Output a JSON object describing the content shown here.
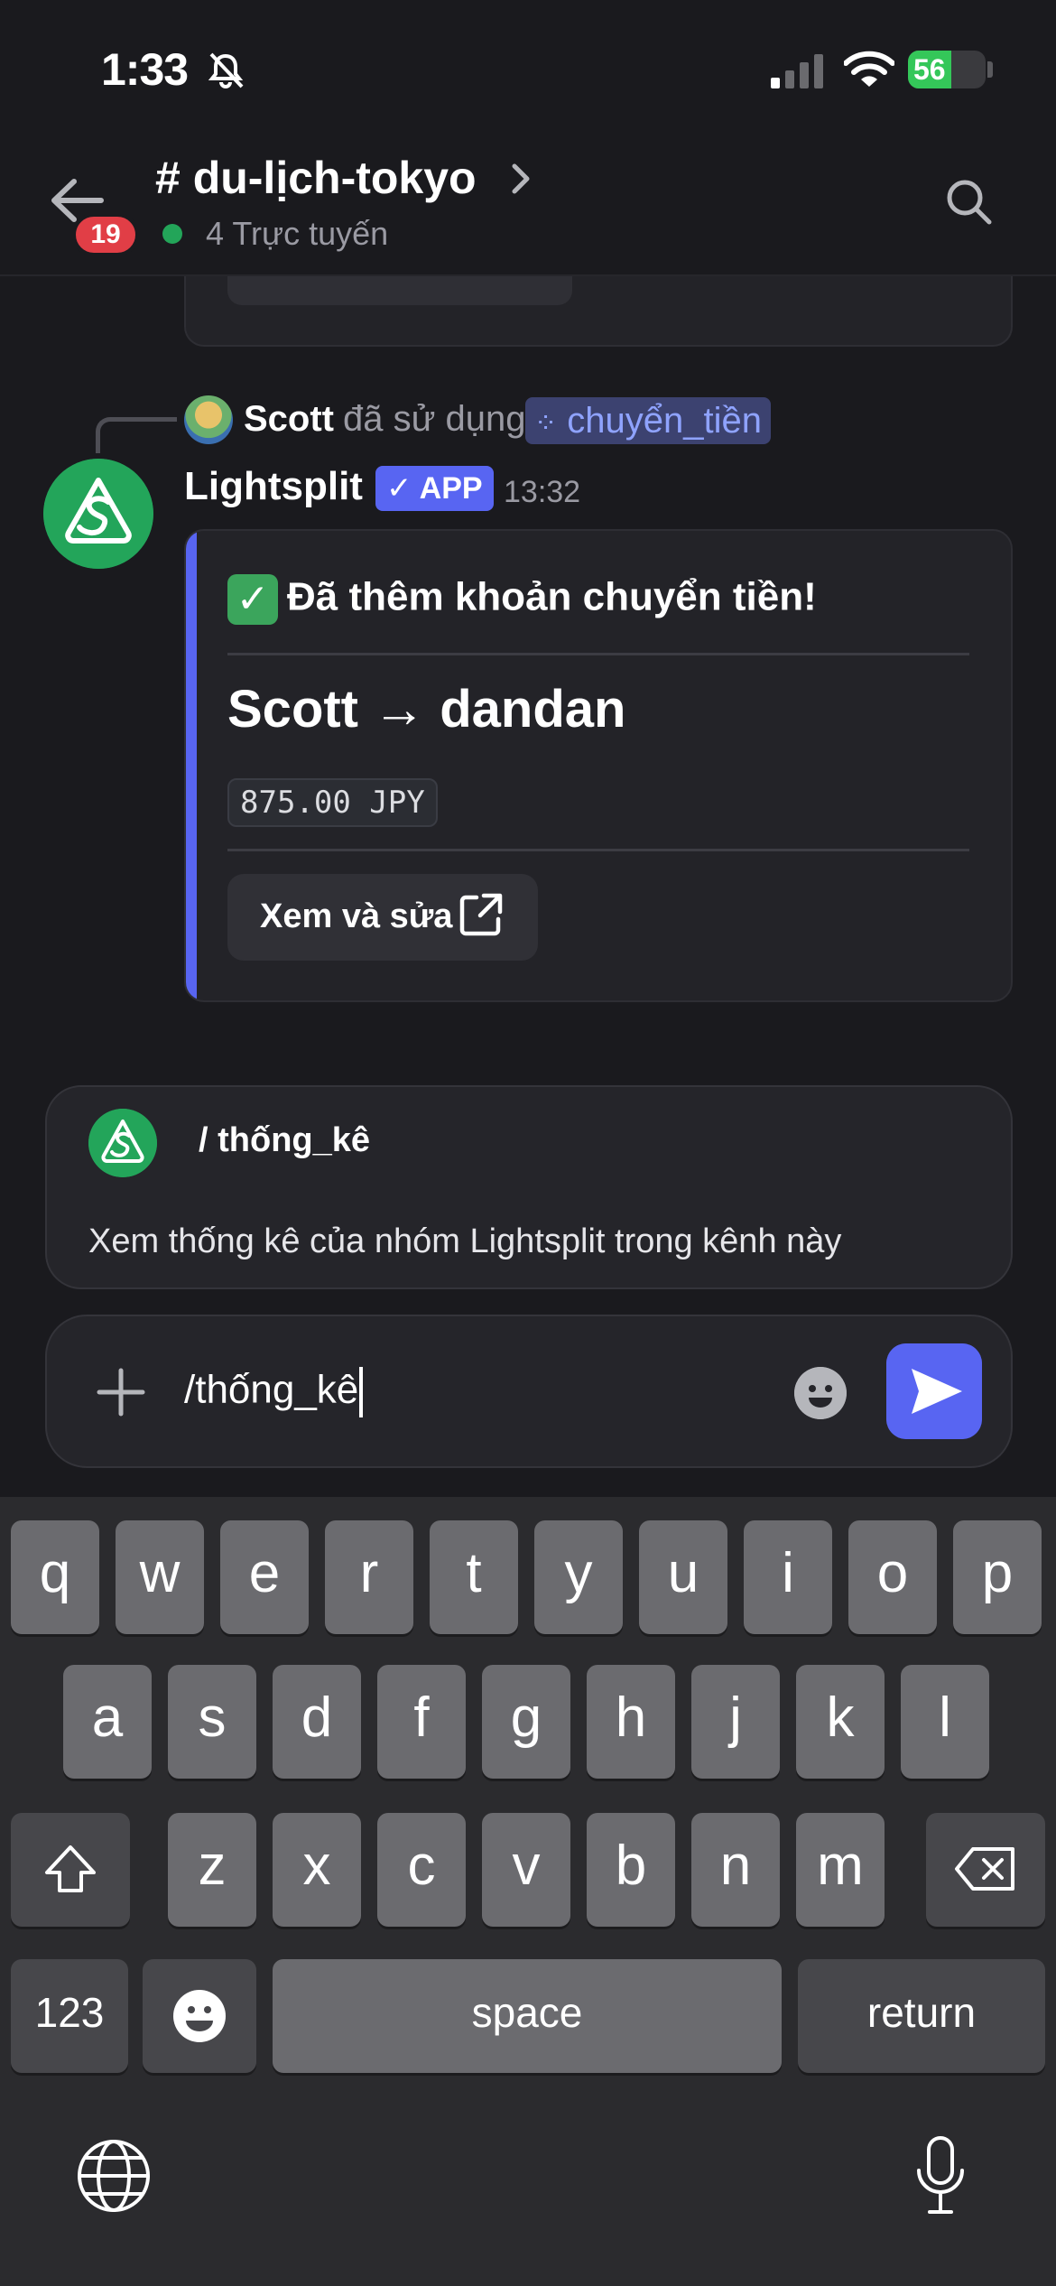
{
  "status": {
    "time": "1:33",
    "battery": "56",
    "battery_level": 0.56
  },
  "header": {
    "unread_count": "19",
    "channel_name": "# du-lịch-tokyo",
    "online_text": "4 Trực tuyến"
  },
  "reply": {
    "user": "Scott",
    "used_text": "đã sử dụng",
    "command": "chuyển_tiền"
  },
  "message": {
    "author": "Lightsplit",
    "badge": "✓ APP",
    "time": "13:32",
    "embed": {
      "title": "Đã thêm khoản chuyển tiền!",
      "transfer": "Scott → dandan",
      "amount": "875.00 JPY",
      "button_label": "Xem và sửa"
    }
  },
  "suggestion": {
    "command": "/ thống_kê",
    "description": "Xem thống kê của nhóm Lightsplit trong kênh này"
  },
  "composer": {
    "text": "/thống_kê"
  },
  "keyboard": {
    "row1": [
      "q",
      "w",
      "e",
      "r",
      "t",
      "y",
      "u",
      "i",
      "o",
      "p"
    ],
    "row2": [
      "a",
      "s",
      "d",
      "f",
      "g",
      "h",
      "j",
      "k",
      "l"
    ],
    "row3": [
      "z",
      "x",
      "c",
      "v",
      "b",
      "n",
      "m"
    ],
    "numbers_label": "123",
    "space_label": "space",
    "return_label": "return"
  },
  "colors": {
    "accent": "#5865f2",
    "online": "#23a559",
    "badge_red": "#e13e46",
    "bot_green": "#23a55a"
  }
}
